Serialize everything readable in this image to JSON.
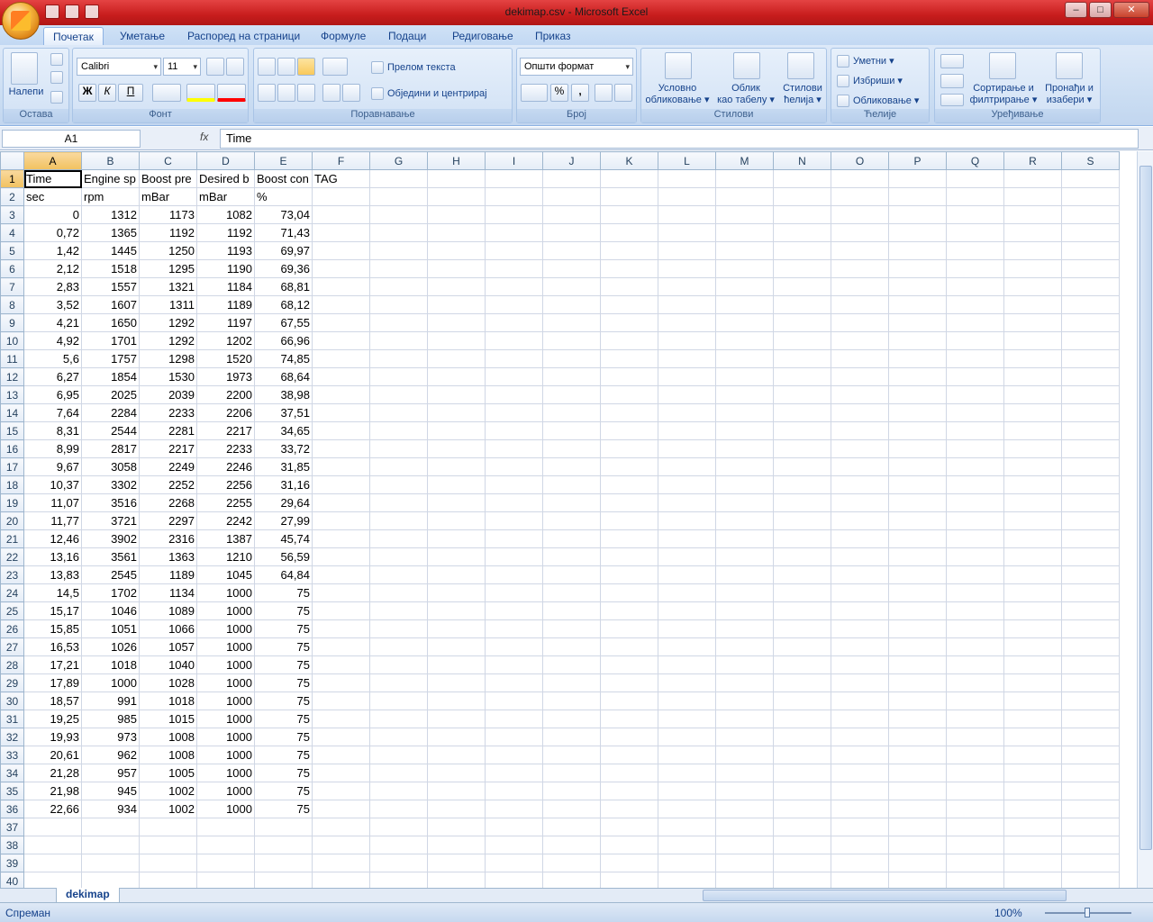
{
  "window": {
    "title": "dekimap.csv - Microsoft Excel",
    "minimize": "–",
    "restore": "□",
    "close": "✕"
  },
  "ribbon_tabs": [
    "Почетак",
    "Уметање",
    "Распоред на страници",
    "Формуле",
    "Подаци",
    "Редиговање",
    "Приказ"
  ],
  "ribbon": {
    "clipboard": {
      "label": "Остава",
      "paste": "Налепи"
    },
    "font": {
      "label": "Фонт",
      "name": "Calibri",
      "size": "11",
      "bold": "Ж",
      "italic": "К",
      "underline": "П"
    },
    "alignment": {
      "label": "Поравнавање",
      "wrap": "Прелом текста",
      "merge": "Обједини и центрирај"
    },
    "number": {
      "label": "Број",
      "format": "Општи формат",
      "percent": "%",
      "comma": ","
    },
    "styles": {
      "label": "Стилови",
      "conditional_1": "Условно",
      "conditional_2": "обликовање",
      "table_1": "Облик",
      "table_2": "као табелу",
      "cell_1": "Стилови",
      "cell_2": "ћелија"
    },
    "cells": {
      "label": "Ћелије",
      "insert": "Уметни",
      "delete": "Избриши",
      "format": "Обликовање"
    },
    "editing": {
      "label": "Уређивање",
      "sort_1": "Сортирање и",
      "sort_2": "филтрирање",
      "find_1": "Пронађи и",
      "find_2": "изабери"
    }
  },
  "name_box": "A1",
  "fx": "fx",
  "formula_text": "Time",
  "columns": [
    "A",
    "B",
    "C",
    "D",
    "E",
    "F",
    "G",
    "H",
    "I",
    "J",
    "K",
    "L",
    "M",
    "N",
    "O",
    "P",
    "Q",
    "R",
    "S"
  ],
  "row_count": 40,
  "header_row": [
    "Time",
    "Engine sp",
    "Boost pre",
    "Desired b",
    "Boost con",
    "TAG"
  ],
  "unit_row": [
    "sec",
    "rpm",
    "mBar",
    "mBar",
    "%"
  ],
  "rows": [
    [
      "0",
      "1312",
      "1173",
      "1082",
      "73,04"
    ],
    [
      "0,72",
      "1365",
      "1192",
      "1192",
      "71,43"
    ],
    [
      "1,42",
      "1445",
      "1250",
      "1193",
      "69,97"
    ],
    [
      "2,12",
      "1518",
      "1295",
      "1190",
      "69,36"
    ],
    [
      "2,83",
      "1557",
      "1321",
      "1184",
      "68,81"
    ],
    [
      "3,52",
      "1607",
      "1311",
      "1189",
      "68,12"
    ],
    [
      "4,21",
      "1650",
      "1292",
      "1197",
      "67,55"
    ],
    [
      "4,92",
      "1701",
      "1292",
      "1202",
      "66,96"
    ],
    [
      "5,6",
      "1757",
      "1298",
      "1520",
      "74,85"
    ],
    [
      "6,27",
      "1854",
      "1530",
      "1973",
      "68,64"
    ],
    [
      "6,95",
      "2025",
      "2039",
      "2200",
      "38,98"
    ],
    [
      "7,64",
      "2284",
      "2233",
      "2206",
      "37,51"
    ],
    [
      "8,31",
      "2544",
      "2281",
      "2217",
      "34,65"
    ],
    [
      "8,99",
      "2817",
      "2217",
      "2233",
      "33,72"
    ],
    [
      "9,67",
      "3058",
      "2249",
      "2246",
      "31,85"
    ],
    [
      "10,37",
      "3302",
      "2252",
      "2256",
      "31,16"
    ],
    [
      "11,07",
      "3516",
      "2268",
      "2255",
      "29,64"
    ],
    [
      "11,77",
      "3721",
      "2297",
      "2242",
      "27,99"
    ],
    [
      "12,46",
      "3902",
      "2316",
      "1387",
      "45,74"
    ],
    [
      "13,16",
      "3561",
      "1363",
      "1210",
      "56,59"
    ],
    [
      "13,83",
      "2545",
      "1189",
      "1045",
      "64,84"
    ],
    [
      "14,5",
      "1702",
      "1134",
      "1000",
      "75"
    ],
    [
      "15,17",
      "1046",
      "1089",
      "1000",
      "75"
    ],
    [
      "15,85",
      "1051",
      "1066",
      "1000",
      "75"
    ],
    [
      "16,53",
      "1026",
      "1057",
      "1000",
      "75"
    ],
    [
      "17,21",
      "1018",
      "1040",
      "1000",
      "75"
    ],
    [
      "17,89",
      "1000",
      "1028",
      "1000",
      "75"
    ],
    [
      "18,57",
      "991",
      "1018",
      "1000",
      "75"
    ],
    [
      "19,25",
      "985",
      "1015",
      "1000",
      "75"
    ],
    [
      "19,93",
      "973",
      "1008",
      "1000",
      "75"
    ],
    [
      "20,61",
      "962",
      "1008",
      "1000",
      "75"
    ],
    [
      "21,28",
      "957",
      "1005",
      "1000",
      "75"
    ],
    [
      "21,98",
      "945",
      "1002",
      "1000",
      "75"
    ],
    [
      "22,66",
      "934",
      "1002",
      "1000",
      "75"
    ]
  ],
  "sheet_tab": "dekimap",
  "status": {
    "ready": "Спреман",
    "zoom": "100%"
  }
}
